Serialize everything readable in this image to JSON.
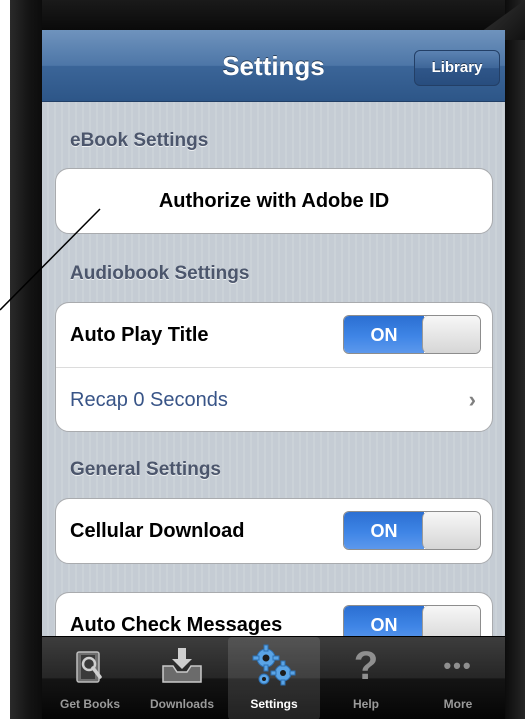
{
  "navbar": {
    "title": "Settings",
    "library_button": "Library"
  },
  "sections": {
    "ebook": {
      "header": "eBook Settings",
      "authorize_label": "Authorize with Adobe ID"
    },
    "audiobook": {
      "header": "Audiobook Settings",
      "auto_play_label": "Auto Play Title",
      "auto_play_value": "ON",
      "recap_label": "Recap 0 Seconds",
      "recap_chevron": "›"
    },
    "general": {
      "header": "General Settings",
      "cellular_label": "Cellular Download",
      "cellular_value": "ON",
      "auto_check_label": "Auto Check Messages",
      "auto_check_value": "ON"
    }
  },
  "tabbar": {
    "items": [
      {
        "label": "Get Books",
        "icon": "book-search-icon",
        "selected": false
      },
      {
        "label": "Downloads",
        "icon": "download-tray-icon",
        "selected": false
      },
      {
        "label": "Settings",
        "icon": "gears-icon",
        "selected": true
      },
      {
        "label": "Help",
        "icon": "question-mark-icon",
        "selected": false
      },
      {
        "label": "More",
        "icon": "more-dots-icon",
        "selected": false
      }
    ],
    "help_glyph": "?",
    "more_glyph": "•••"
  },
  "colors": {
    "nav_blue": "#3b6598",
    "switch_on_blue": "#3f85e6",
    "link_blue": "#385487",
    "section_header_text": "#4c566c",
    "background_stripe": "#c5ccd4"
  }
}
